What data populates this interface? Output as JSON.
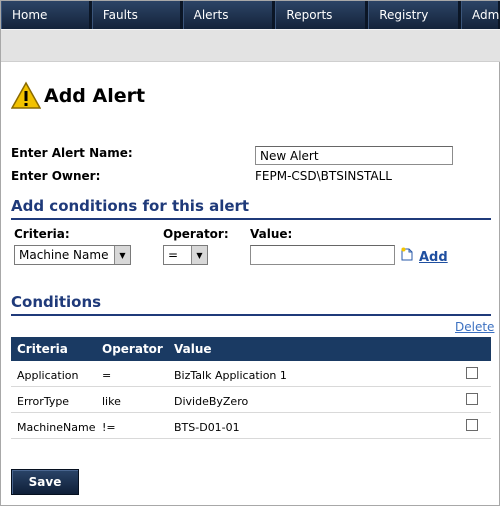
{
  "nav": {
    "tabs": [
      {
        "label": "Home"
      },
      {
        "label": "Faults"
      },
      {
        "label": "Alerts"
      },
      {
        "label": "Reports"
      },
      {
        "label": "Registry"
      },
      {
        "label": "Adm"
      }
    ]
  },
  "page": {
    "title": "Add Alert",
    "icon": "warning-icon"
  },
  "form": {
    "alert_name_label": "Enter Alert Name:",
    "alert_name_value": "New Alert",
    "owner_label": "Enter Owner:",
    "owner_value": "FEPM-CSD\\BTSINSTALL"
  },
  "add_conditions": {
    "section_title": "Add conditions for this alert",
    "criteria_label": "Criteria:",
    "criteria_selected": "Machine Name",
    "operator_label": "Operator:",
    "operator_selected": "=",
    "value_label": "Value:",
    "value_input": "",
    "add_label": "Add"
  },
  "conditions": {
    "section_title": "Conditions",
    "delete_label": "Delete",
    "columns": [
      "Criteria",
      "Operator",
      "Value"
    ],
    "rows": [
      {
        "criteria": "Application",
        "operator": "=",
        "value": "BizTalk Application 1",
        "checked": false
      },
      {
        "criteria": "ErrorType",
        "operator": "like",
        "value": "DivideByZero",
        "checked": false
      },
      {
        "criteria": "MachineName",
        "operator": "!=",
        "value": "BTS-D01-01",
        "checked": false
      }
    ]
  },
  "actions": {
    "save_label": "Save"
  },
  "colors": {
    "nav_bg": "#1b2c44",
    "section_title": "#1f3a7a",
    "table_header": "#1a3a63",
    "link": "#1f4fa0"
  }
}
